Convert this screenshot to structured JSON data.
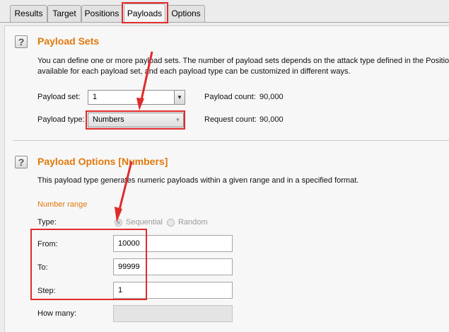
{
  "tabs": [
    {
      "label": "Results"
    },
    {
      "label": "Target"
    },
    {
      "label": "Positions"
    },
    {
      "label": "Payloads",
      "active": true
    },
    {
      "label": "Options"
    }
  ],
  "payload_sets": {
    "title": "Payload Sets",
    "description_line1": "You can define one or more payload sets. The number of payload sets depends on the attack type defined in the Position",
    "description_line2": "available for each payload set, and each payload type can be customized in different ways.",
    "payload_set_label": "Payload set:",
    "payload_set_value": "1",
    "payload_type_label": "Payload type:",
    "payload_type_value": "Numbers",
    "payload_count_label": "Payload count:",
    "payload_count_value": "90,000",
    "request_count_label": "Request count:",
    "request_count_value": "90,000"
  },
  "payload_options": {
    "title": "Payload Options [Numbers]",
    "description": "This payload type generates numeric payloads within a given range and in a specified format.",
    "number_range_label": "Number range",
    "type_label": "Type:",
    "type_options": [
      "Sequential",
      "Random"
    ],
    "type_selected": "Sequential",
    "from_label": "From:",
    "from_value": "10000",
    "to_label": "To:",
    "to_value": "99999",
    "step_label": "Step:",
    "step_value": "1",
    "how_many_label": "How many:",
    "how_many_value": ""
  },
  "colors": {
    "section_title": "#e2780c",
    "annotation_red": "#e12b2b"
  }
}
